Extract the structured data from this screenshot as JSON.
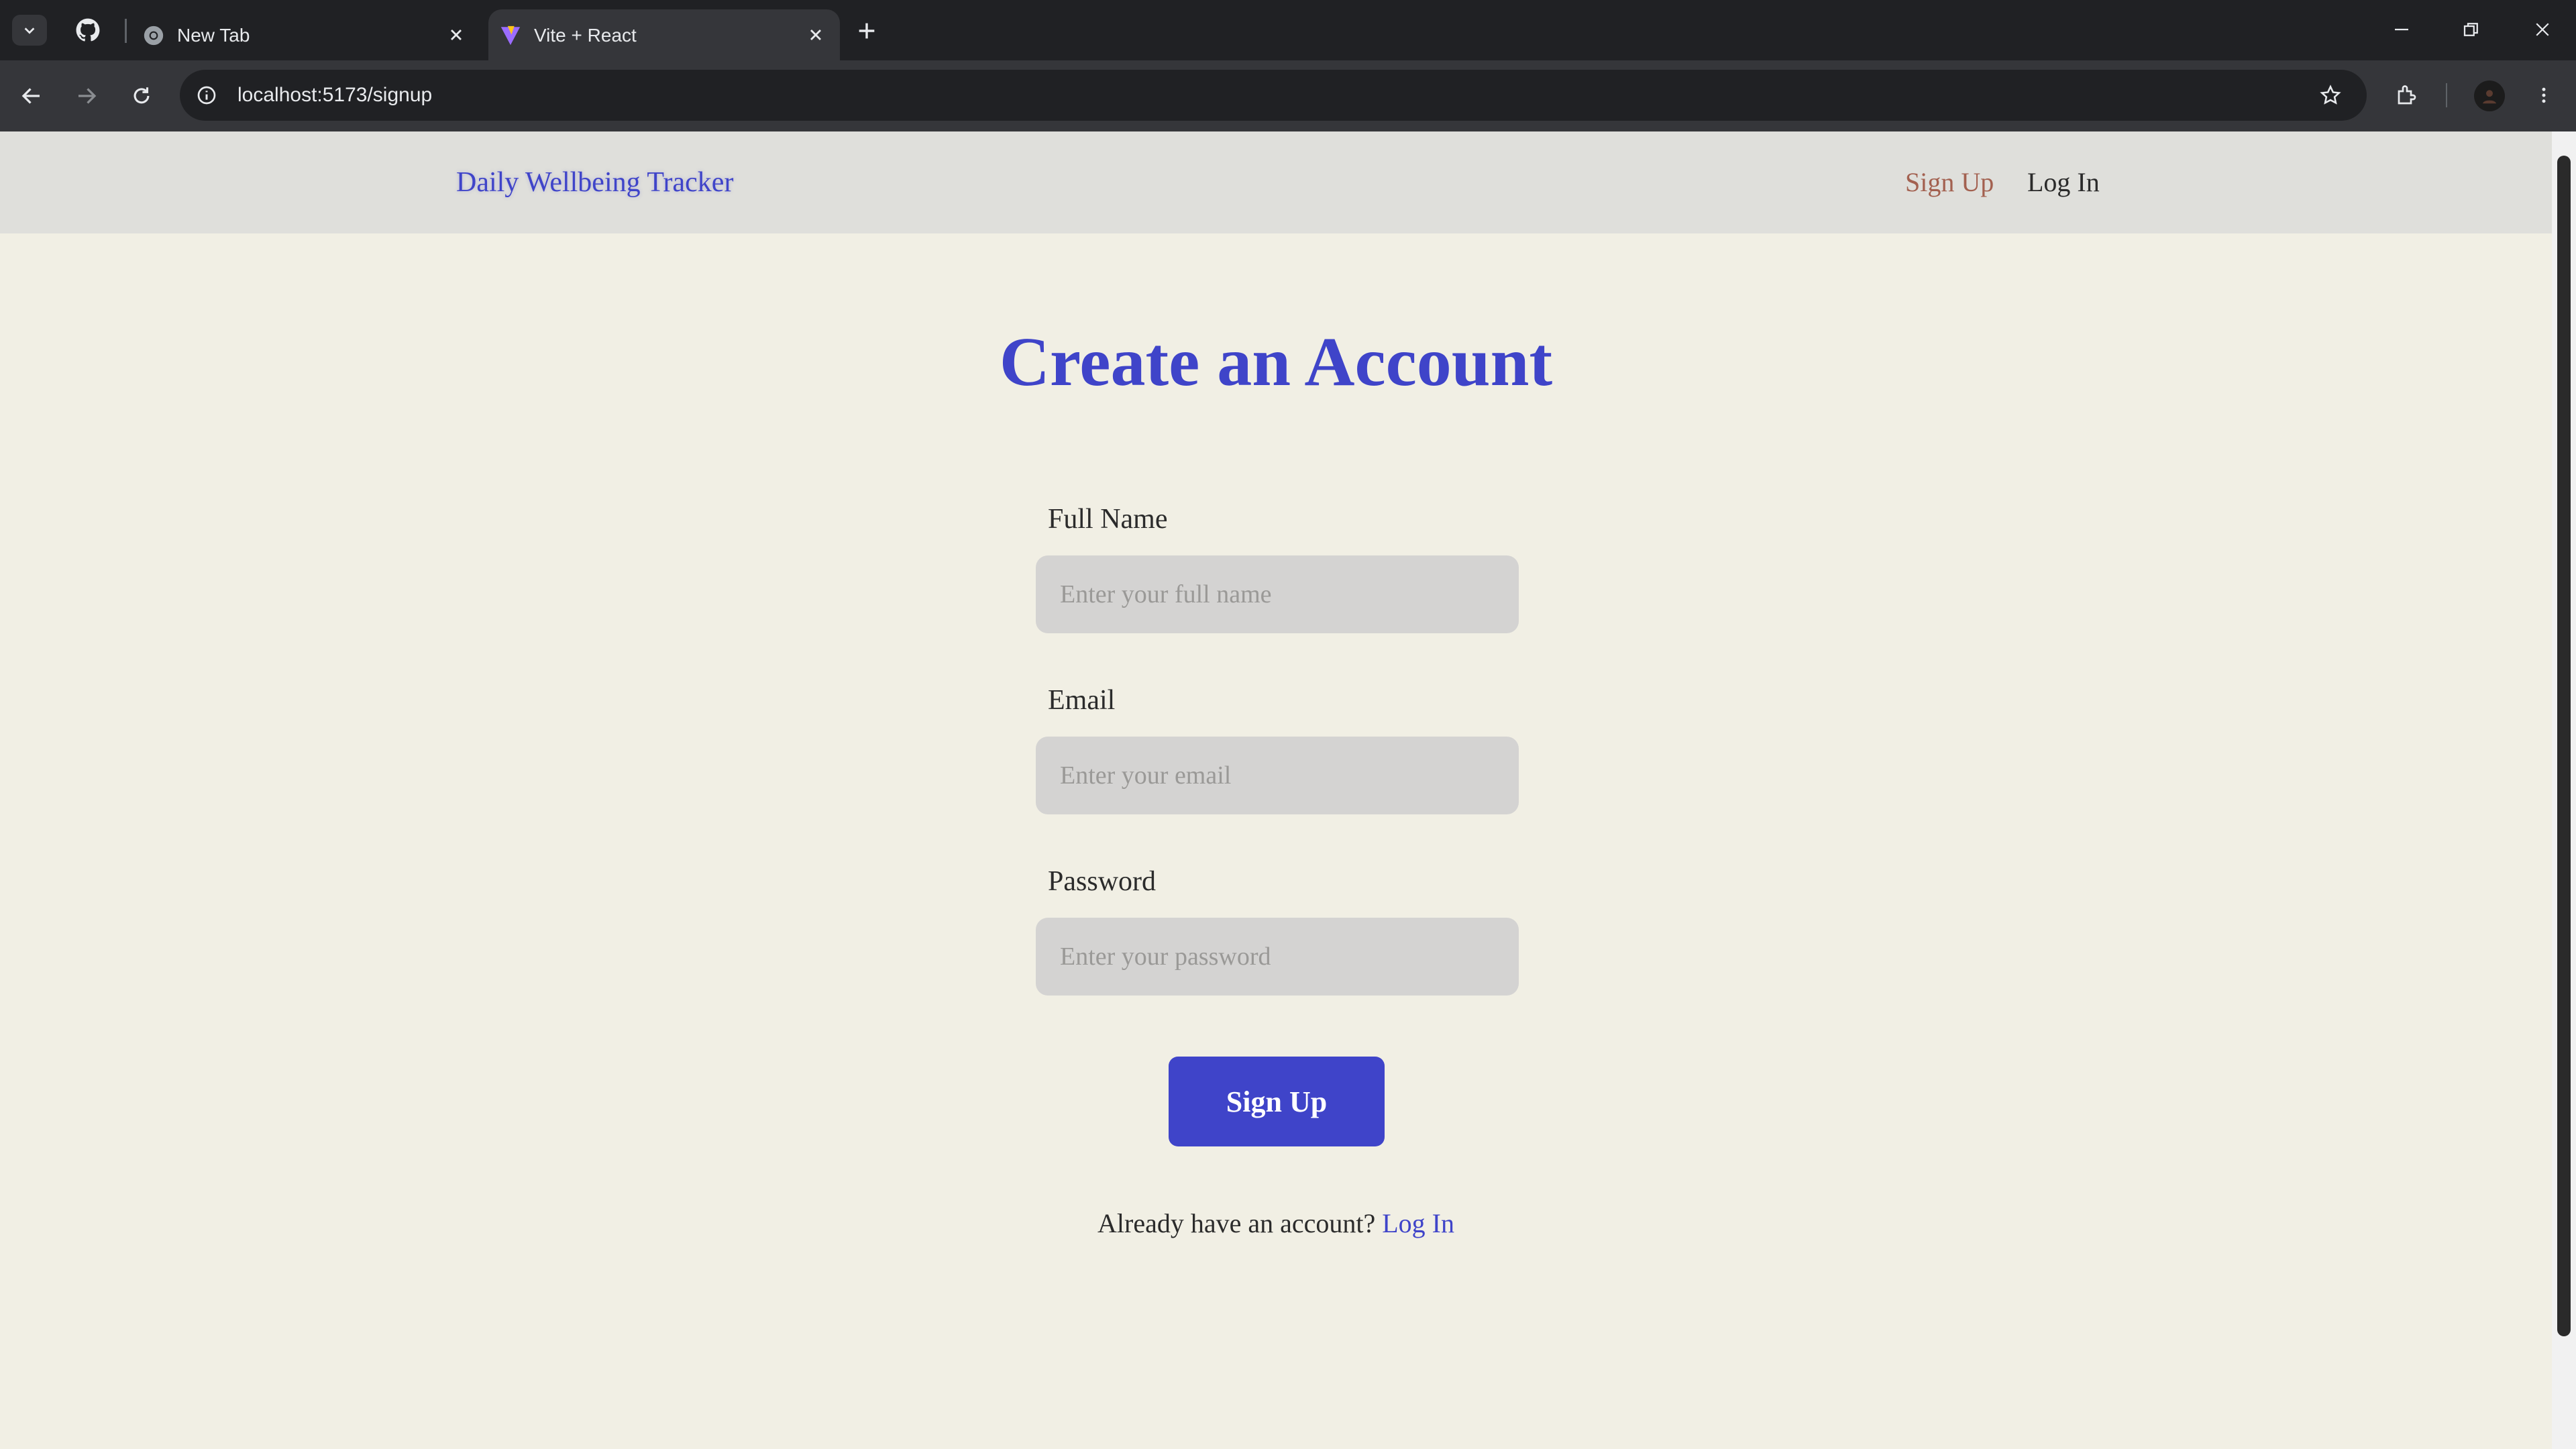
{
  "browser": {
    "tabs": [
      {
        "title": "New Tab",
        "favicon": "chrome-icon",
        "active": false
      },
      {
        "title": "Vite + React",
        "favicon": "vite-icon",
        "active": true
      }
    ],
    "url": "localhost:5173/signup",
    "icons": [
      "tab-search-icon",
      "github-icon",
      "new-tab-icon",
      "minimize-icon",
      "restore-icon",
      "close-window-icon",
      "back-icon",
      "forward-icon",
      "reload-icon",
      "site-info-icon",
      "bookmark-star-icon",
      "extensions-icon",
      "profile-avatar",
      "menu-dots-icon"
    ]
  },
  "navbar": {
    "brand": "Daily Wellbeing Tracker",
    "links": [
      {
        "label": "Sign Up",
        "active": true
      },
      {
        "label": "Log In",
        "active": false
      }
    ]
  },
  "form": {
    "title": "Create an Account",
    "fields": [
      {
        "label": "Full Name",
        "placeholder": "Enter your full name",
        "value": ""
      },
      {
        "label": "Email",
        "placeholder": "Enter your email",
        "value": ""
      },
      {
        "label": "Password",
        "placeholder": "Enter your password",
        "value": ""
      }
    ],
    "submit_label": "Sign Up",
    "footer_prompt": "Already have an account?",
    "footer_link": "Log In"
  },
  "colors": {
    "accent": "#3f44c9",
    "active_nav": "#a36150",
    "page_bg": "#f1efe4",
    "navbar_bg": "#dfdfdb",
    "input_bg": "#d4d3d2"
  }
}
